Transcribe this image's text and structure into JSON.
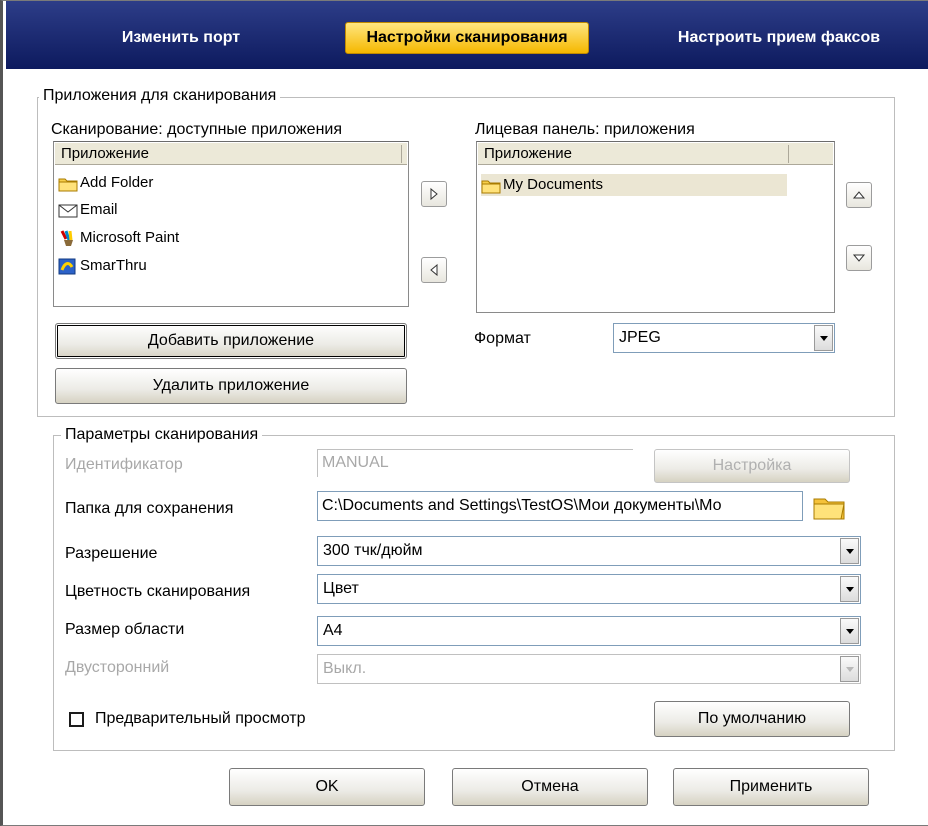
{
  "tabs": [
    {
      "label": "Изменить порт"
    },
    {
      "label": "Настройки сканирования"
    },
    {
      "label": "Настроить прием факсов"
    }
  ],
  "apps_group": {
    "legend": "Приложения для сканирования",
    "available": {
      "label": "Сканирование: доступные приложения",
      "column": "Приложение",
      "items": [
        {
          "label": "Add Folder",
          "icon": "folder-icon"
        },
        {
          "label": "Email",
          "icon": "envelope-icon"
        },
        {
          "label": "Microsoft Paint",
          "icon": "paint-icon"
        },
        {
          "label": "SmarThru",
          "icon": "smarthru-icon"
        }
      ]
    },
    "panel": {
      "label": "Лицевая панель: приложения",
      "column": "Приложение",
      "items": [
        {
          "label": "My Documents",
          "icon": "folder-icon"
        }
      ]
    },
    "add_button": "Добавить приложение",
    "remove_button": "Удалить приложение",
    "format_label": "Формат",
    "format_value": "JPEG"
  },
  "scan_group": {
    "legend": "Параметры сканирования",
    "id_label": "Идентификатор",
    "id_value": "MANUAL",
    "setup_button": "Настройка",
    "folder_label": "Папка для сохранения",
    "folder_value": "C:\\Documents and Settings\\TestOS\\Мои документы\\Мо",
    "resolution_label": "Разрешение",
    "resolution_value": "300 тчк/дюйм",
    "color_label": "Цветность сканирования",
    "color_value": "Цвет",
    "size_label": "Размер области",
    "size_value": "A4",
    "duplex_label": "Двусторонний",
    "duplex_value": "Выкл.",
    "preview_label": "Предварительный просмотр",
    "default_button": "По умолчанию"
  },
  "footer": {
    "ok": "OK",
    "cancel": "Отмена",
    "apply": "Применить"
  }
}
